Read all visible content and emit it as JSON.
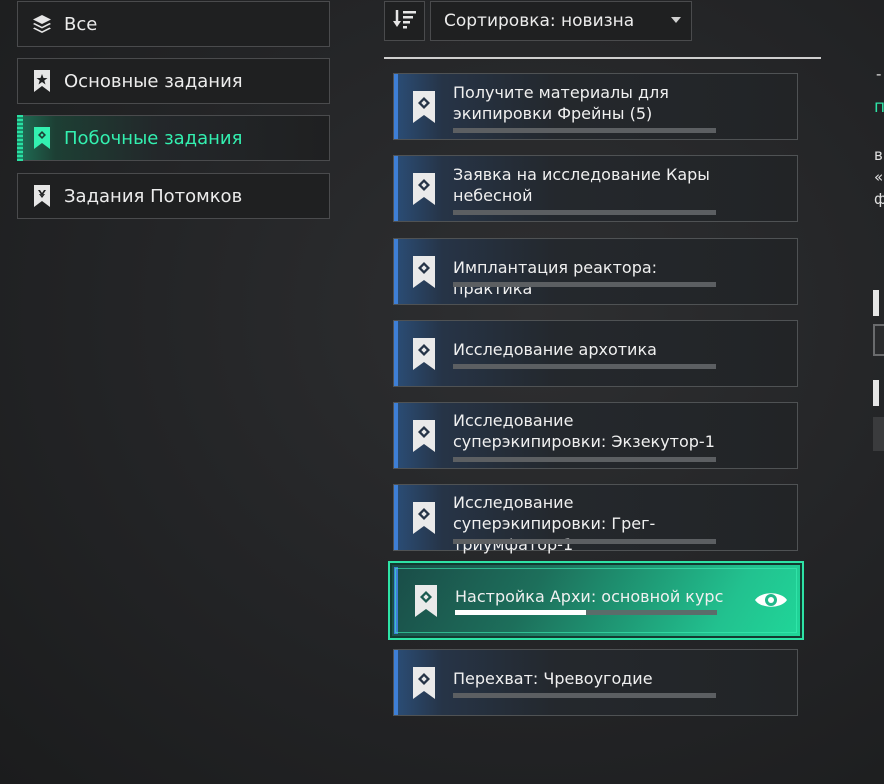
{
  "categories": [
    {
      "label": "Все",
      "icon": "layers-icon"
    },
    {
      "label": "Основные задания",
      "icon": "main-quest-icon"
    },
    {
      "label": "Побочные задания",
      "icon": "side-quest-icon",
      "active": true
    },
    {
      "label": "Задания Потомков",
      "icon": "descendant-quest-icon"
    }
  ],
  "sort": {
    "label": "Сортировка: новизна",
    "icon": "sort-icon"
  },
  "quests": [
    {
      "title": "Получите материалы для экипировки Фрейны (5)",
      "progress": 0
    },
    {
      "title": "Заявка на исследование Кары небесной",
      "progress": 0
    },
    {
      "title": "Имплантация реактора: практика",
      "progress": 0
    },
    {
      "title": "Исследование архотика",
      "progress": 0
    },
    {
      "title": "Исследование суперэкипировки: Экзекутор-1",
      "progress": 0
    },
    {
      "title": "Исследование суперэкипировки: Грег-триумфатор-1",
      "progress": 0
    },
    {
      "title": "Настройка Архи: основной курс",
      "progress": 0.5,
      "active": true,
      "tracked": true
    },
    {
      "title": "Перехват: Чревоугодие",
      "progress": 0
    }
  ],
  "right_panel": {
    "accent": "#2ee3a6",
    "frag1": "-",
    "frag2": "п",
    "frag3": "в",
    "frag4": "«",
    "frag5": "ф"
  },
  "colors": {
    "accent": "#33f0b0",
    "quest_edge": "#3e7fd6"
  }
}
